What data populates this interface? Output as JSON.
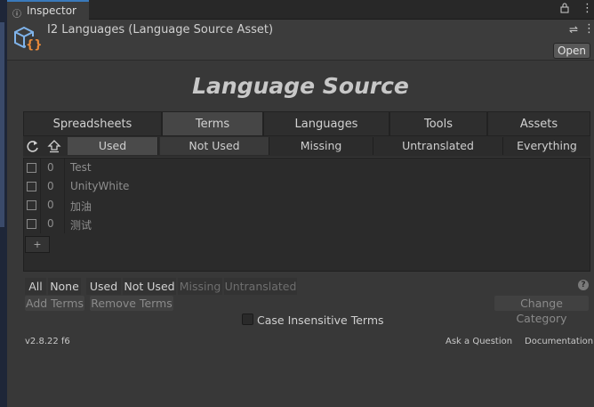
{
  "window": {
    "tab_label": "Inspector",
    "tab_icon": "info-icon"
  },
  "header": {
    "title": "I2 Languages (Language Source Asset)",
    "open_label": "Open",
    "asset_icon": "cube-braces-icon"
  },
  "main_title": "Language Source",
  "main_tabs": [
    "Spreadsheets",
    "Terms",
    "Languages",
    "Tools",
    "Assets"
  ],
  "selected_tab": "Terms",
  "usage_filters": [
    "Used",
    "Not Used",
    "Missing",
    "Untranslated",
    "Everything"
  ],
  "selected_filter": "Used",
  "terms": [
    {
      "usage": "0",
      "name": "Test"
    },
    {
      "usage": "0",
      "name": "UnityWhite"
    },
    {
      "usage": "0",
      "name": "加油"
    },
    {
      "usage": "0",
      "name": "测试"
    }
  ],
  "add_label": "+",
  "select_buttons": [
    "All",
    "None",
    "Used",
    "Not Used",
    "Missing",
    "Untranslated"
  ],
  "actions": {
    "add_terms": "Add Terms",
    "remove_terms": "Remove Terms",
    "change_category": "Change Category"
  },
  "case_insensitive_label": "Case Insensitive Terms",
  "footer": {
    "version": "v2.8.22 f6",
    "ask": "Ask a Question",
    "docs": "Documentation"
  },
  "colors": {
    "accent": "#3a79bb",
    "panel": "#383838",
    "selected": "#464646"
  }
}
